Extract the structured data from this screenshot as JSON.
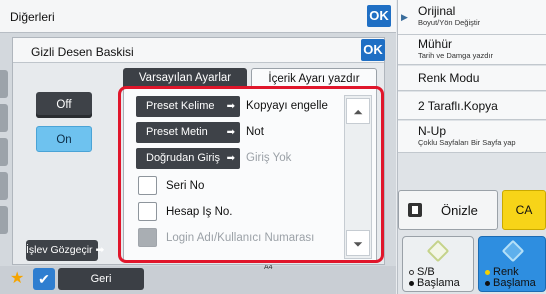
{
  "outer_dialog": {
    "title": "Diğerleri",
    "ok_label": "OK"
  },
  "inner_dialog": {
    "title": "Gizli Desen Baskisi",
    "ok_label": "OK",
    "tabs": [
      {
        "label": "Varsayılan Ayarlar",
        "active": false
      },
      {
        "label": "İçerik Ayarı yazdır",
        "active": true
      }
    ],
    "off_label": "Off",
    "on_label": "On",
    "on_selected": true,
    "islev_label": "İşlev Gözgeçir",
    "rows": [
      {
        "button": "Preset Kelime",
        "value": "Kopyayı engelle",
        "dim": false
      },
      {
        "button": "Preset Metin",
        "value": "Not",
        "dim": false
      },
      {
        "button": "Doğrudan Giriş",
        "value": "Giriş Yok",
        "dim": true
      }
    ],
    "checks": [
      {
        "label": "Seri No",
        "disabled": false
      },
      {
        "label": "Hesap Iş No.",
        "disabled": false
      },
      {
        "label": "Login Adı/Kullanıcı Numarası",
        "disabled": true
      }
    ]
  },
  "bottom_bar": {
    "back_label": "Geri",
    "stub_text": "A4"
  },
  "right_panel": {
    "items": [
      {
        "main": "Orijinal",
        "sub": "Boyut/Yön Değiştir"
      },
      {
        "main": "Mühür",
        "sub": "Tarih ve Damga yazdır"
      },
      {
        "main": "Renk Modu",
        "sub": ""
      },
      {
        "main": "2 Taraflı.Kopya",
        "sub": ""
      },
      {
        "main": "N-Up",
        "sub": "Çoklu Sayfaları Bir Sayfa yap"
      }
    ],
    "preview_label": "Önizle",
    "ca_label": "CA",
    "start_bw": {
      "line1": "S/B",
      "line2": "Başlama"
    },
    "start_color": {
      "line1": "Renk",
      "line2": "Başlama"
    }
  },
  "colors": {
    "accent": "#1f6fc4",
    "highlight": "#e0162b",
    "on_button": "#6ec2ef",
    "color_start": "#2e8ee0",
    "ca": "#f7d418"
  }
}
